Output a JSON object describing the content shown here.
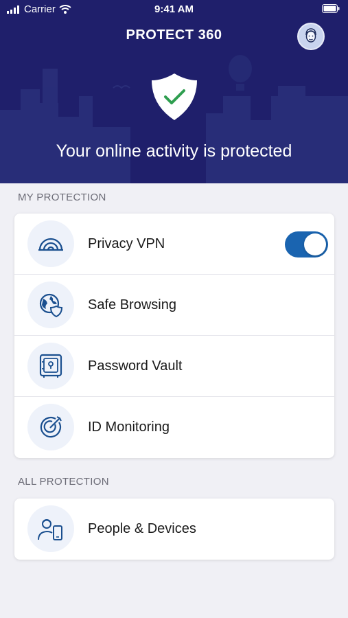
{
  "status_bar": {
    "carrier": "Carrier",
    "time": "9:41 AM"
  },
  "header": {
    "title": "PROTECT 360",
    "status_message": "Your online activity is protected"
  },
  "colors": {
    "header_bg": "#1f1f6b",
    "accent": "#1a64b0",
    "check": "#2e9e4f"
  },
  "my_protection": {
    "label": "MY PROTECTION",
    "items": [
      {
        "label": "Privacy VPN",
        "icon": "vpn-signal-icon",
        "toggle": true
      },
      {
        "label": "Safe Browsing",
        "icon": "globe-shield-icon"
      },
      {
        "label": "Password Vault",
        "icon": "vault-safe-icon"
      },
      {
        "label": "ID Monitoring",
        "icon": "target-radar-icon"
      }
    ]
  },
  "all_protection": {
    "label": "ALL PROTECTION",
    "items": [
      {
        "label": "People & Devices",
        "icon": "person-phone-icon"
      }
    ]
  }
}
